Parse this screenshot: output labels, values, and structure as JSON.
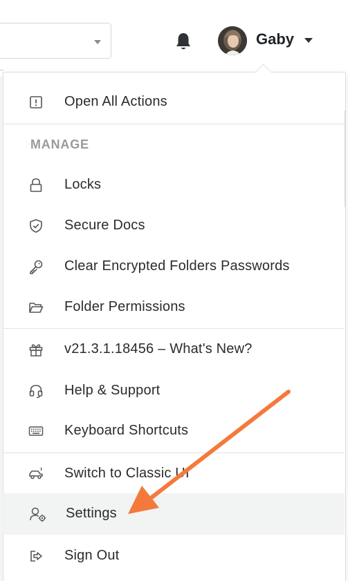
{
  "header": {
    "user_name": "Gaby"
  },
  "menu": {
    "open_all_actions": "Open All Actions",
    "section_manage": "MANAGE",
    "locks": "Locks",
    "secure_docs": "Secure Docs",
    "clear_encrypted": "Clear Encrypted Folders Passwords",
    "folder_permissions": "Folder Permissions",
    "whats_new": "v21.3.1.18456 – What's New?",
    "help_support": "Help & Support",
    "keyboard_shortcuts": "Keyboard Shortcuts",
    "switch_classic": "Switch to Classic UI",
    "settings": "Settings",
    "sign_out": "Sign Out"
  },
  "icons": {
    "open_all_actions": "exclamation-box-icon",
    "locks": "lock-icon",
    "secure_docs": "shield-check-icon",
    "clear_encrypted": "key-icon",
    "folder_permissions": "folder-open-icon",
    "whats_new": "gift-icon",
    "help_support": "headset-icon",
    "keyboard_shortcuts": "keyboard-icon",
    "switch_classic": "car-icon",
    "settings": "user-gear-icon",
    "sign_out": "sign-out-icon"
  },
  "colors": {
    "annotation_arrow": "#f47a3c",
    "highlight_row": "#f2f3f3",
    "section_label": "#9a9a9a"
  }
}
